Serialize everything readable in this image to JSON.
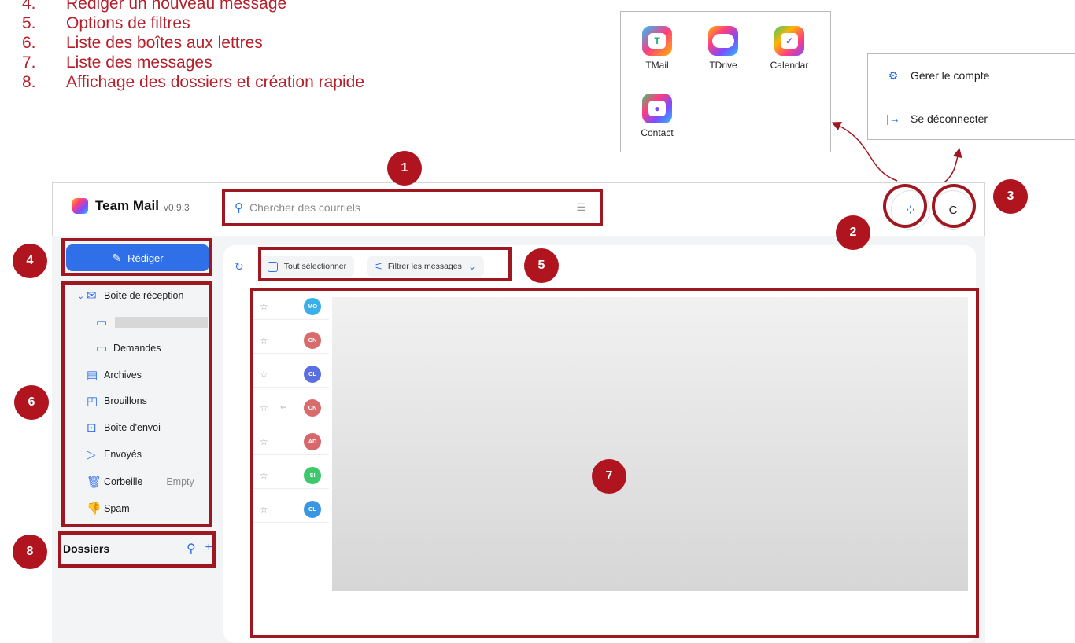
{
  "legend": [
    {
      "num": "4.",
      "text": "Rédiger un nouveau message"
    },
    {
      "num": "5.",
      "text": "Options de filtres"
    },
    {
      "num": "6.",
      "text": "Liste des boîtes aux lettres"
    },
    {
      "num": "7.",
      "text": "Liste des messages"
    },
    {
      "num": "8.",
      "text": "Affichage des dossiers et création rapide"
    }
  ],
  "launcher": {
    "apps": [
      {
        "name": "TMail",
        "icon": "tmail-icon"
      },
      {
        "name": "TDrive",
        "icon": "tdrive-icon"
      },
      {
        "name": "Calendar",
        "icon": "calendar-icon"
      },
      {
        "name": "Contact",
        "icon": "contact-icon"
      }
    ]
  },
  "account_menu": {
    "manage": "Gérer le compte",
    "logout": "Se déconnecter"
  },
  "header": {
    "app_name": "Team Mail",
    "version": "v0.9.3",
    "search_placeholder": "Chercher des courriels",
    "avatar_letter": "C"
  },
  "sidebar": {
    "compose": "Rédiger",
    "mailboxes": [
      {
        "label": "Boîte de réception",
        "icon": "inbox-icon"
      },
      {
        "label": "",
        "icon": "folder-icon"
      },
      {
        "label": "Demandes",
        "icon": "folder-icon"
      },
      {
        "label": "Archives",
        "icon": "archive-icon"
      },
      {
        "label": "Brouillons",
        "icon": "draft-icon"
      },
      {
        "label": "Boîte d'envoi",
        "icon": "outbox-icon"
      },
      {
        "label": "Envoyés",
        "icon": "send-icon"
      },
      {
        "label": "Corbeille",
        "icon": "trash-icon",
        "extra": "Empty"
      },
      {
        "label": "Spam",
        "icon": "spam-icon"
      }
    ],
    "folders_title": "Dossiers"
  },
  "toolbar": {
    "select_all": "Tout sélectionner",
    "filter": "Filtrer les messages"
  },
  "messages": [
    {
      "initials": "MO",
      "color": "#3ab0e8"
    },
    {
      "initials": "CN",
      "color": "#d86b6b"
    },
    {
      "initials": "CL",
      "color": "#5b6fe0"
    },
    {
      "initials": "CN",
      "color": "#d86b6b"
    },
    {
      "initials": "AD",
      "color": "#d8676b"
    },
    {
      "initials": "SI",
      "color": "#3cc86b"
    },
    {
      "initials": "CL",
      "color": "#3a96e0"
    }
  ],
  "annotations": [
    "1",
    "2",
    "3",
    "4",
    "5",
    "6",
    "7",
    "8"
  ],
  "colors": {
    "accent": "#2f6fe8",
    "annotation": "#b0141e"
  }
}
